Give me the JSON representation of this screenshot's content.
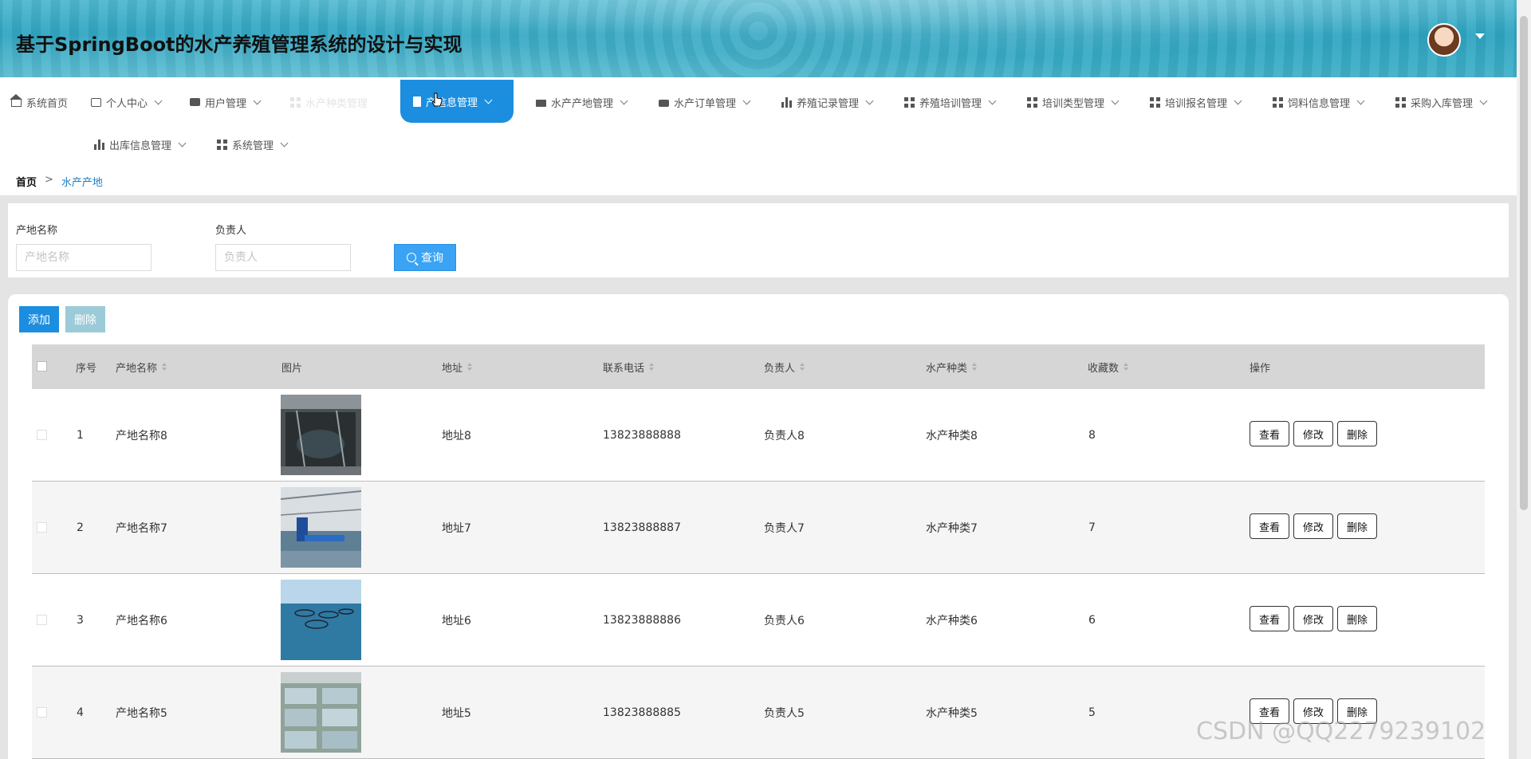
{
  "header": {
    "title": "基于SpringBoot的水产养殖管理系统的设计与实现"
  },
  "nav": {
    "items": [
      {
        "label": "系统首页",
        "icon": "home-icon"
      },
      {
        "label": "个人中心",
        "icon": "card-icon"
      },
      {
        "label": "用户管理",
        "icon": "chat-icon"
      },
      {
        "label": "水产种类管理",
        "icon": "grid-icon"
      },
      {
        "label": "产信息管理",
        "icon": "doc-icon"
      },
      {
        "label": "水产产地管理",
        "icon": "bag-icon"
      },
      {
        "label": "水产订单管理",
        "icon": "briefcase-icon"
      },
      {
        "label": "养殖记录管理",
        "icon": "bars-icon"
      },
      {
        "label": "养殖培训管理",
        "icon": "grid-icon"
      },
      {
        "label": "培训类型管理",
        "icon": "grid-icon"
      },
      {
        "label": "培训报名管理",
        "icon": "grid-icon"
      },
      {
        "label": "饲料信息管理",
        "icon": "grid-icon"
      },
      {
        "label": "采购入库管理",
        "icon": "grid-icon"
      },
      {
        "label": "出库信息管理",
        "icon": "bars-icon"
      },
      {
        "label": "系统管理",
        "icon": "grid-icon"
      }
    ]
  },
  "breadcrumb": {
    "home": "首页",
    "separator": ">",
    "current": "水产产地"
  },
  "search": {
    "name_label": "产地名称",
    "name_placeholder": "产地名称",
    "owner_label": "负责人",
    "owner_placeholder": "负责人",
    "query_label": "查询"
  },
  "toolbar": {
    "add_label": "添加",
    "delete_label": "删除"
  },
  "table": {
    "headers": [
      "序号",
      "产地名称",
      "图片",
      "地址",
      "联系电话",
      "负责人",
      "水产种类",
      "收藏数",
      "操作"
    ],
    "rows": [
      {
        "index": "1",
        "name": "产地名称8",
        "address": "地址8",
        "phone": "13823888888",
        "owner": "负责人8",
        "species": "水产种类8",
        "favorites": "8"
      },
      {
        "index": "2",
        "name": "产地名称7",
        "address": "地址7",
        "phone": "13823888887",
        "owner": "负责人7",
        "species": "水产种类7",
        "favorites": "7"
      },
      {
        "index": "3",
        "name": "产地名称6",
        "address": "地址6",
        "phone": "13823888886",
        "owner": "负责人6",
        "species": "水产种类6",
        "favorites": "6"
      },
      {
        "index": "4",
        "name": "产地名称5",
        "address": "地址5",
        "phone": "13823888885",
        "owner": "负责人5",
        "species": "水产种类5",
        "favorites": "5"
      }
    ],
    "actions": {
      "view": "查看",
      "edit": "修改",
      "delete": "删除"
    }
  },
  "watermark": "CSDN @QQ2279239102",
  "colors": {
    "accent": "#1b8ee0",
    "query": "#3aa3f3",
    "delete_disabled": "#9bcbd8"
  }
}
